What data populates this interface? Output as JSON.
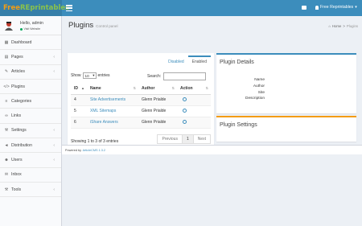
{
  "header": {
    "logo_prefix": "Free",
    "logo_main": "REprintables",
    "user_label": "Free Reprintables",
    "accent_color": "#3c8dbc",
    "icons": [
      "menu-toggle-icon",
      "mail-icon",
      "user-icon"
    ]
  },
  "sidebar": {
    "greeting": "Hello, admin",
    "visit_link": "Visit Website",
    "items": [
      {
        "label": "Dashboard",
        "icon": "dashboard-icon",
        "has_children": false
      },
      {
        "label": "Pages",
        "icon": "file-icon",
        "has_children": true
      },
      {
        "label": "Articles",
        "icon": "edit-icon",
        "has_children": true
      },
      {
        "label": "Plugins",
        "icon": "code-icon",
        "has_children": false
      },
      {
        "label": "Categories",
        "icon": "stack-icon",
        "has_children": false
      },
      {
        "label": "Links",
        "icon": "link-icon",
        "has_children": false
      },
      {
        "label": "Settings",
        "icon": "wrench-icon",
        "has_children": true
      },
      {
        "label": "Distribution",
        "icon": "bullhorn-icon",
        "has_children": true
      },
      {
        "label": "Users",
        "icon": "users-icon",
        "has_children": true
      },
      {
        "label": "Inbox",
        "icon": "envelope-icon",
        "has_children": false
      },
      {
        "label": "Tools",
        "icon": "wrench-icon",
        "has_children": true
      }
    ]
  },
  "page": {
    "title": "Plugins",
    "subtitle": "Control panel",
    "breadcrumb_home": "Home",
    "breadcrumb_current": "Plugins"
  },
  "plugins_box": {
    "tabs": [
      "Disabled",
      "Enabled"
    ],
    "active_tab": "Enabled",
    "show_label": "Show",
    "entries_value": "10",
    "entries_label": "entries",
    "search_label": "Search:",
    "columns": [
      "ID",
      "Name",
      "Author",
      "Action"
    ],
    "rows": [
      {
        "id": "4",
        "name": "Site Advertisements",
        "author": "Glenn Prialde"
      },
      {
        "id": "5",
        "name": "XML Sitemaps",
        "author": "Glenn Prialde"
      },
      {
        "id": "6",
        "name": "iShare Answers",
        "author": "Glenn Prialde"
      }
    ],
    "info": "Showing 1 to 3 of 3 entries",
    "pager": {
      "previous": "Previous",
      "page": "1",
      "next": "Next"
    }
  },
  "details_box": {
    "title": "Plugin Details",
    "fields": [
      "Name",
      "Author",
      "Site",
      "Description"
    ]
  },
  "settings_box": {
    "title": "Plugin Settings"
  },
  "footer": {
    "powered_by": "Powered by",
    "product": "ArticleCMS 1.3.2"
  }
}
